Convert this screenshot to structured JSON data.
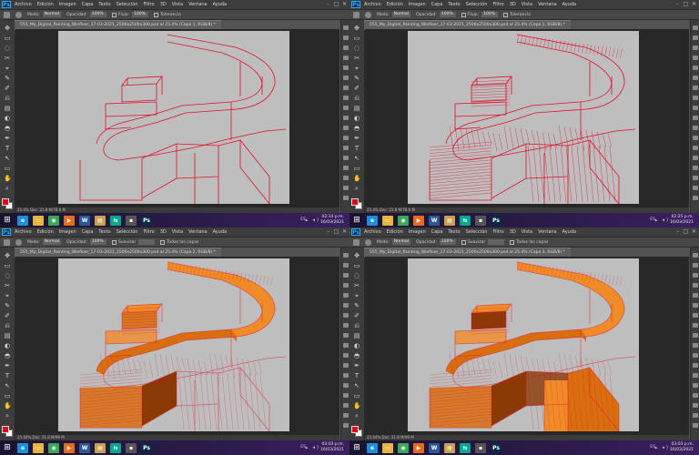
{
  "menu": [
    "Archivo",
    "Edición",
    "Imagen",
    "Capa",
    "Texto",
    "Selección",
    "Filtro",
    "3D",
    "Vista",
    "Ventana",
    "Ayuda"
  ],
  "ps_logo": "Ps",
  "window_controls": [
    "–",
    "□",
    "✕"
  ],
  "quadrants": [
    {
      "options": {
        "mode_label": "Modo:",
        "mode_value": "Normal",
        "opacity_label": "Opacidad:",
        "opacity_value": "100%",
        "flow_label": "Flujo:",
        "flow_value": "100%",
        "extra_label": "Tolerancia"
      },
      "doc_tab": "555_My_Digital_Painting_Wiefloer_17-03-2021_2500x2500x300.psd al 25.4% (Capa 1, RGB/8) *",
      "status": "25.4%   Doc: 21.8 M/78.6 M",
      "clock_time": "02:14 p.m.",
      "clock_date": "16/03/2021",
      "lang": "ES"
    },
    {
      "options": {
        "mode_label": "Modo:",
        "mode_value": "Normal",
        "opacity_label": "Opacidad:",
        "opacity_value": "100%",
        "flow_label": "Flujo:",
        "flow_value": "100%",
        "extra_label": "Tolerancia"
      },
      "doc_tab": "555_My_Digital_Painting_Wiefloer_17-03-2021_2500x2500x300.psd al 25.4% (Capa 1, RGB/8) *",
      "status": "25.4%   Doc: 21.8 M/78.6 M",
      "clock_time": "02:25 p.m.",
      "clock_date": "16/03/2021",
      "lang": "ES"
    },
    {
      "options": {
        "mode_label": "Modo:",
        "mode_value": "Normal",
        "opacity_label": "Opacidad:",
        "opacity_value": "100%",
        "flow_label": "Suavizar",
        "flow_value": "",
        "extra_label": "Todas las capas"
      },
      "doc_tab": "555_My_Digital_Painting_Wiefloer_17-03-2021_2500x2500x300.psd al 25.4% (Capa 2, RGB/8) *",
      "status": "25.44%   Doc: 21.8 M/99 M",
      "clock_time": "03:03 p.m.",
      "clock_date": "16/03/2021",
      "lang": "ES"
    },
    {
      "options": {
        "mode_label": "Modo:",
        "mode_value": "Normal",
        "opacity_label": "Opacidad:",
        "opacity_value": "100%",
        "flow_label": "Suavizar",
        "flow_value": "",
        "extra_label": "Todas las capas"
      },
      "doc_tab": "555_My_Digital_Painting_Wiefloer_17-03-2021_2500x2500x300.psd al 25.4% (Capa 3, RGB/8) *",
      "status": "25.44%   Doc: 21.8 M/99 M",
      "clock_time": "03:03 p.m.",
      "clock_date": "16/03/2021",
      "lang": "ES"
    }
  ],
  "taskbar_apps": [
    {
      "icon": "internet-explorer-icon",
      "glyph": "e",
      "color": "#1d8fe0"
    },
    {
      "icon": "file-explorer-icon",
      "glyph": "▭",
      "color": "#e8b53c"
    },
    {
      "icon": "chrome-icon",
      "glyph": "◉",
      "color": "#3aa757"
    },
    {
      "icon": "media-player-icon",
      "glyph": "▶",
      "color": "#e86a1c"
    },
    {
      "icon": "word-icon",
      "glyph": "W",
      "color": "#2b5797"
    },
    {
      "icon": "folder-icon",
      "glyph": "▤",
      "color": "#c8a050"
    },
    {
      "icon": "network-icon",
      "glyph": "⇆",
      "color": "#00a88e"
    },
    {
      "icon": "terminal-icon",
      "glyph": "▪",
      "color": "#555555"
    },
    {
      "icon": "photoshop-icon",
      "glyph": "Ps",
      "color": "#0a2a44"
    }
  ],
  "colors": {
    "foreground_swatch": "#e0001a",
    "line_color": "#e0102c",
    "orange_light": "#f08c28",
    "orange_mid": "#d96e10",
    "orange_dark": "#8a3a04"
  }
}
